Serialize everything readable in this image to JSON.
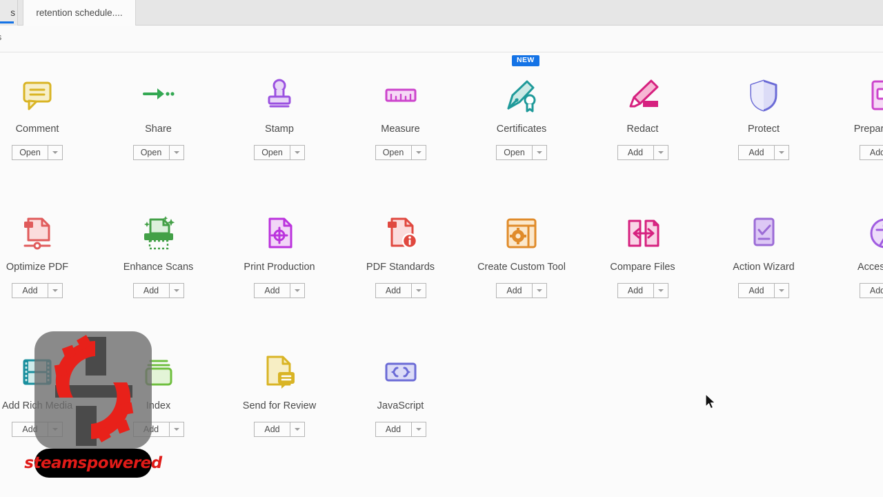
{
  "window": {
    "tab_partial_label": "s",
    "active_tab_label": "retention schedule....",
    "subbar_fragment": "s"
  },
  "tools": {
    "badge_new_label": "NEW",
    "open_label": "Open",
    "add_label": "Add",
    "items": [
      {
        "name": "Comment",
        "icon": "comment-bubble-icon",
        "action": "Open",
        "badge": null,
        "col": 0,
        "row": 0
      },
      {
        "name": "Share",
        "icon": "share-arrow-icon",
        "action": "Open",
        "badge": null,
        "col": 1,
        "row": 0
      },
      {
        "name": "Stamp",
        "icon": "stamp-icon",
        "action": "Open",
        "badge": null,
        "col": 2,
        "row": 0
      },
      {
        "name": "Measure",
        "icon": "ruler-icon",
        "action": "Open",
        "badge": null,
        "col": 3,
        "row": 0
      },
      {
        "name": "Certificates",
        "icon": "certificate-pen-icon",
        "action": "Open",
        "badge": "NEW",
        "col": 4,
        "row": 0
      },
      {
        "name": "Redact",
        "icon": "marker-redact-icon",
        "action": "Add",
        "badge": null,
        "col": 5,
        "row": 0
      },
      {
        "name": "Protect",
        "icon": "shield-icon",
        "action": "Add",
        "badge": null,
        "col": 6,
        "row": 0
      },
      {
        "name": "Prepare Form",
        "icon": "form-field-icon",
        "action": "Add",
        "badge": null,
        "col": 7,
        "row": 0
      },
      {
        "name": "Optimize PDF",
        "icon": "optimize-pdf-icon",
        "action": "Add",
        "badge": null,
        "col": 0,
        "row": 1
      },
      {
        "name": "Enhance Scans",
        "icon": "scanner-icon",
        "action": "Add",
        "badge": null,
        "col": 1,
        "row": 1
      },
      {
        "name": "Print Production",
        "icon": "print-registration-icon",
        "action": "Add",
        "badge": null,
        "col": 2,
        "row": 1
      },
      {
        "name": "PDF Standards",
        "icon": "pdf-standards-info-icon",
        "action": "Add",
        "badge": null,
        "col": 3,
        "row": 1
      },
      {
        "name": "Create Custom Tool",
        "icon": "custom-tool-gear-icon",
        "action": "Add",
        "badge": null,
        "col": 4,
        "row": 1
      },
      {
        "name": "Compare Files",
        "icon": "compare-files-icon",
        "action": "Add",
        "badge": null,
        "col": 5,
        "row": 1
      },
      {
        "name": "Action Wizard",
        "icon": "action-wizard-icon",
        "action": "Add",
        "badge": null,
        "col": 6,
        "row": 1
      },
      {
        "name": "Accessibility",
        "icon": "accessibility-icon",
        "action": "Add",
        "badge": null,
        "col": 7,
        "row": 1
      },
      {
        "name": "Add Rich Media",
        "icon": "film-strip-icon",
        "action": "Add",
        "badge": null,
        "col": 0,
        "row": 2
      },
      {
        "name": "Index",
        "icon": "index-cards-icon",
        "action": "Add",
        "badge": null,
        "col": 1,
        "row": 2
      },
      {
        "name": "Send for Review",
        "icon": "send-for-review-icon",
        "action": "Add",
        "badge": null,
        "col": 2,
        "row": 2
      },
      {
        "name": "JavaScript",
        "icon": "javascript-braces-icon",
        "action": "Add",
        "badge": null,
        "col": 3,
        "row": 2
      }
    ]
  },
  "watermark": {
    "text": "steamspowered",
    "logo_color": "#e8211a",
    "plate_color": "#6e6e6e",
    "text_bg_color": "#000000"
  },
  "colors": {
    "comment": "#d9b425",
    "share": "#33a852",
    "stamp": "#9b51e0",
    "measure": "#cc44cc",
    "certificates": "#1f9a9a",
    "redact": "#d6217f",
    "protect": "#6b6bd6",
    "prepare_form": "#cc44cc",
    "optimize": "#e05b5b",
    "enhance": "#43a047",
    "print_production": "#bb33dd",
    "pdf_standards": "#e0483f",
    "create_custom": "#e08b2a",
    "compare": "#d6217f",
    "action_wizard": "#9b6bd6",
    "accessibility": "#a05ce0",
    "rich_media": "#1a8f9e",
    "index": "#6fbf3f",
    "send_review": "#d9b425",
    "javascript": "#6b6bd6",
    "badge_blue": "#1473e6"
  }
}
